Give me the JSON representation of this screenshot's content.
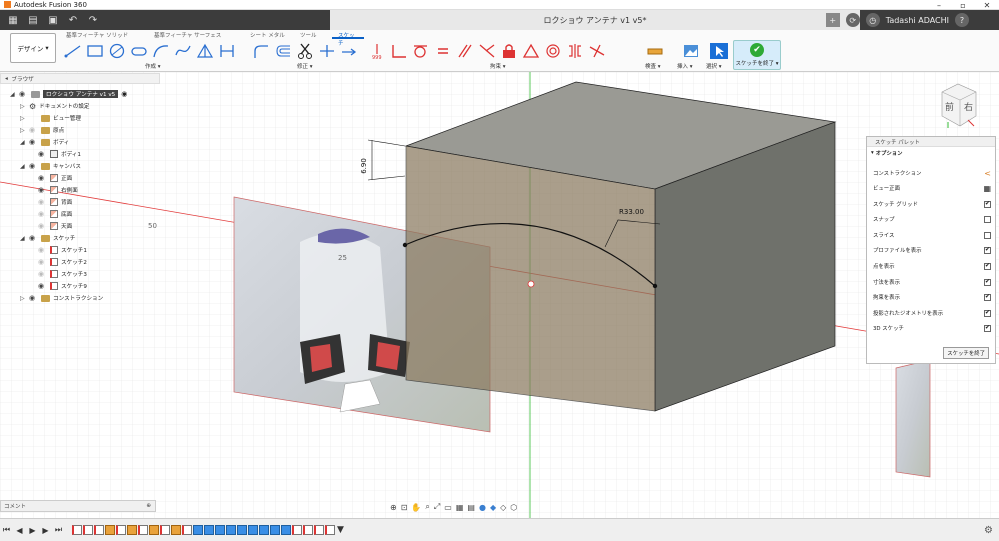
{
  "app": {
    "title": "Autodesk Fusion 360"
  },
  "document": {
    "tab_title": "ロクショウ アンテナ v1 v5*",
    "user": "Tadashi ADACHI"
  },
  "ribbon": {
    "tabs": [
      {
        "label": "基準フィーチャ ソリッド"
      },
      {
        "label": "基準フィーチャ サーフェス"
      },
      {
        "label": "シート メタル"
      },
      {
        "label": "ツール"
      },
      {
        "label": "スケッチ"
      }
    ],
    "workspace": "デザイン",
    "groups": {
      "create": "作成",
      "modify": "修正",
      "constraints": "拘束",
      "inspect": "検査",
      "insert": "挿入",
      "select": "選択"
    },
    "finish_sketch": "スケッチを終了"
  },
  "browser": {
    "title": "ブラウザ",
    "root": "ロクショウ アンテナ v1 v5",
    "items": [
      {
        "label": "ドキュメントの設定"
      },
      {
        "label": "ビュー管理"
      },
      {
        "label": "原点"
      },
      {
        "label": "ボディ"
      },
      {
        "label": "ボディ1"
      },
      {
        "label": "キャンバス"
      },
      {
        "label": "正面"
      },
      {
        "label": "右側面"
      },
      {
        "label": "背面"
      },
      {
        "label": "底面"
      },
      {
        "label": "天面"
      },
      {
        "label": "スケッチ"
      },
      {
        "label": "スケッチ1"
      },
      {
        "label": "スケッチ2"
      },
      {
        "label": "スケッチ3"
      },
      {
        "label": "スケッチ9"
      },
      {
        "label": "コンストラクション"
      }
    ]
  },
  "sketch_palette": {
    "title": "スケッチ パレット",
    "section": "オプション",
    "options": [
      {
        "label": "コンストラクション",
        "control": "icon"
      },
      {
        "label": "ビュー正面",
        "control": "icon"
      },
      {
        "label": "スケッチ グリッド",
        "checked": "✔"
      },
      {
        "label": "スナップ",
        "checked": ""
      },
      {
        "label": "スライス",
        "checked": ""
      },
      {
        "label": "プロファイルを表示",
        "checked": "✔"
      },
      {
        "label": "点を表示",
        "checked": "✔"
      },
      {
        "label": "寸法を表示",
        "checked": "✔"
      },
      {
        "label": "拘束を表示",
        "checked": "✔"
      },
      {
        "label": "投影されたジオメトリを表示",
        "checked": "✔"
      },
      {
        "label": "3D スケッチ",
        "checked": "✔"
      }
    ],
    "finish_button": "スケッチを終了"
  },
  "canvas": {
    "dim_vertical": "6.90",
    "dim_radius": "R33.00",
    "axis_label_50": "50",
    "axis_label_25": "25"
  },
  "viewcube": {
    "front": "前",
    "right": "右"
  },
  "comments": {
    "label": "コメント"
  },
  "colors": {
    "accent": "#0a60c6",
    "finish_green": "#2eaa36",
    "box_face": "#7a7a72",
    "axis_red": "#e23b3b",
    "axis_green": "#33bb33"
  }
}
